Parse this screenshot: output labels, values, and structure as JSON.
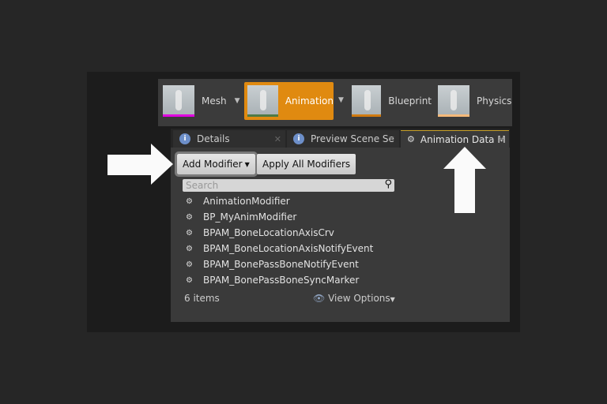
{
  "modes": [
    {
      "label": "Mesh",
      "bar": "#e000e0",
      "dropdown": true
    },
    {
      "label": "Animation",
      "bar": "#4e7a45",
      "dropdown": true,
      "active": true
    },
    {
      "label": "Blueprint",
      "bar": "#d07a10",
      "dropdown": false
    },
    {
      "label": "Physics",
      "bar": "#f5b97a",
      "dropdown": false
    }
  ],
  "tabs": [
    {
      "label": "Details",
      "icon": "info-icon"
    },
    {
      "label": "Preview Scene Se",
      "icon": "info-icon"
    },
    {
      "label": "Animation Data M",
      "icon": "modifier-icon",
      "active": true
    }
  ],
  "toolbar": {
    "add_modifier": "Add Modifier",
    "apply_all": "Apply All Modifiers"
  },
  "search": {
    "placeholder": "Search",
    "value": ""
  },
  "items": [
    "AnimationModifier",
    "BP_MyAnimModifier",
    "BPAM_BoneLocationAxisCrv",
    "BPAM_BoneLocationAxisNotifyEvent",
    "BPAM_BonePassBoneNotifyEvent",
    "BPAM_BonePassBoneSyncMarker"
  ],
  "footer": {
    "count": "6 items",
    "view_options": "View Options"
  }
}
